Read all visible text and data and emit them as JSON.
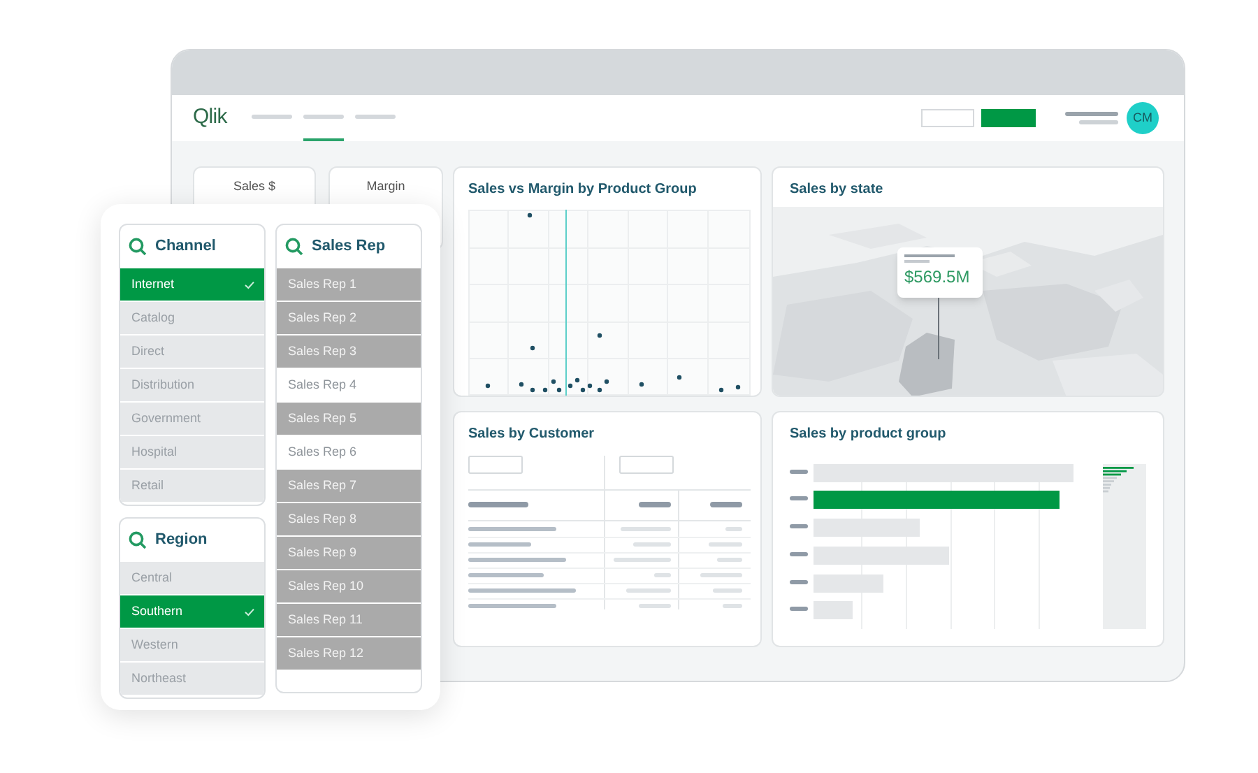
{
  "app": {
    "logo": "Qlik",
    "avatar": "CM"
  },
  "nav_tabs": [
    {
      "selected": false
    },
    {
      "selected": true
    },
    {
      "selected": false
    }
  ],
  "kpis": [
    {
      "label": "Sales $"
    },
    {
      "label": "Margin"
    }
  ],
  "scatter": {
    "title": "Sales vs Margin by Product Group"
  },
  "map": {
    "title": "Sales by state",
    "tooltip_value": "$569.5M"
  },
  "customer_table": {
    "title": "Sales by Customer"
  },
  "product_chart": {
    "title": "Sales by product group"
  },
  "filters": [
    {
      "title": "Channel",
      "items": [
        {
          "label": "Internet",
          "selected": true
        },
        {
          "label": "Catalog",
          "selected": false,
          "kind": "excluded"
        },
        {
          "label": "Direct",
          "selected": false,
          "kind": "excluded"
        },
        {
          "label": "Distribution",
          "selected": false,
          "kind": "excluded"
        },
        {
          "label": "Government",
          "selected": false,
          "kind": "excluded"
        },
        {
          "label": "Hospital",
          "selected": false,
          "kind": "excluded"
        },
        {
          "label": "Retail",
          "selected": false,
          "kind": "excluded"
        }
      ]
    },
    {
      "title": "Region",
      "items": [
        {
          "label": "Central",
          "selected": false,
          "kind": "excluded"
        },
        {
          "label": "Southern",
          "selected": true
        },
        {
          "label": "Western",
          "selected": false,
          "kind": "excluded"
        },
        {
          "label": "Northeast",
          "selected": false,
          "kind": "excluded"
        }
      ]
    },
    {
      "title": "Sales Rep",
      "items": [
        {
          "label": "Sales Rep 1",
          "selected": false,
          "kind": "alternative"
        },
        {
          "label": "Sales Rep 2",
          "selected": false,
          "kind": "alternative"
        },
        {
          "label": "Sales Rep 3",
          "selected": false,
          "kind": "alternative"
        },
        {
          "label": "Sales Rep 4",
          "selected": false,
          "kind": "possible"
        },
        {
          "label": "Sales Rep 5",
          "selected": false,
          "kind": "alternative"
        },
        {
          "label": "Sales Rep 6",
          "selected": false,
          "kind": "possible"
        },
        {
          "label": "Sales Rep 7",
          "selected": false,
          "kind": "alternative"
        },
        {
          "label": "Sales Rep 8",
          "selected": false,
          "kind": "alternative"
        },
        {
          "label": "Sales Rep 9",
          "selected": false,
          "kind": "alternative"
        },
        {
          "label": "Sales Rep 10",
          "selected": false,
          "kind": "alternative"
        },
        {
          "label": "Sales Rep 11",
          "selected": false,
          "kind": "alternative"
        },
        {
          "label": "Sales Rep 12",
          "selected": false,
          "kind": "alternative"
        }
      ]
    }
  ]
}
